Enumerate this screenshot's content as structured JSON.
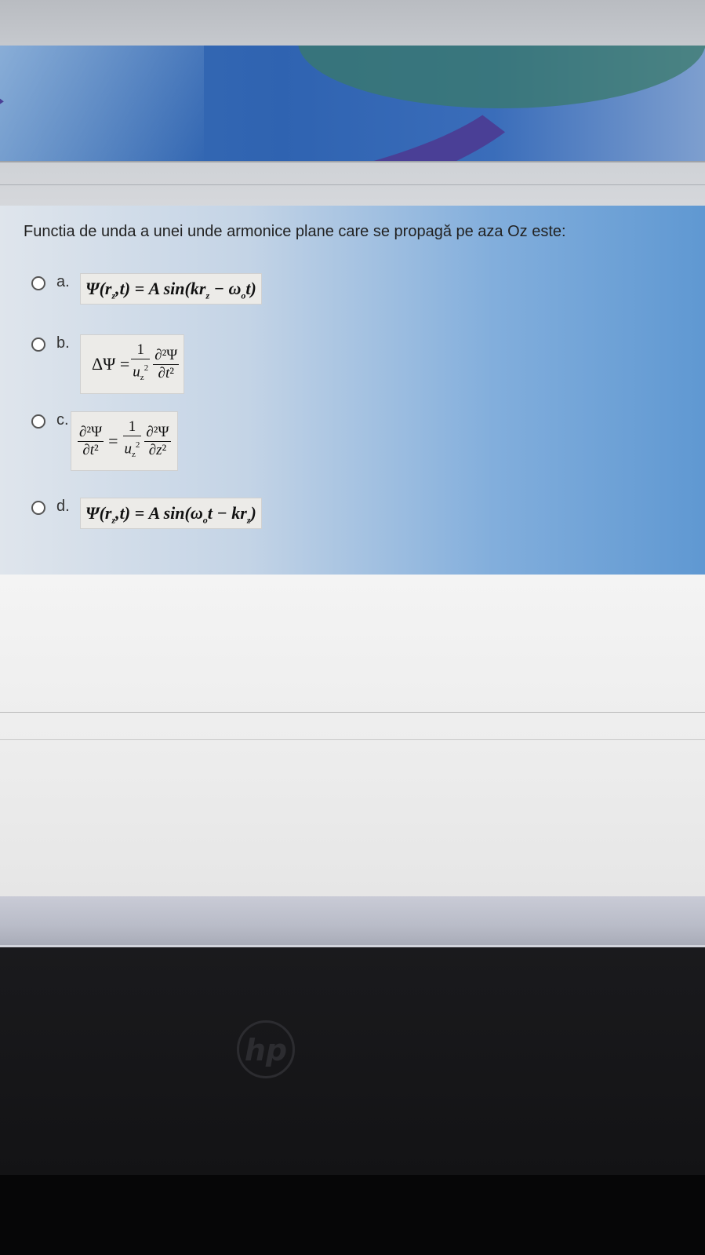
{
  "question": {
    "text": "Functia de unda a unei unde armonice plane care se propagă pe aza Oz este:"
  },
  "options": [
    {
      "letter": "a.",
      "formula_text": "Ψ(r_z,t) = A sin(kr_z − ω_0 t)",
      "selected": false
    },
    {
      "letter": "b.",
      "formula_text": "ΔΨ = (1/u_z²) ∂²Ψ/∂t²",
      "selected": false
    },
    {
      "letter": "c.",
      "formula_text": "∂²Ψ/∂t² = (1/u_z²) ∂²Ψ/∂z²",
      "selected": false
    },
    {
      "letter": "d.",
      "formula_text": "Ψ(r_z,t) = A sin(ω_0 t − kr_z)",
      "selected": false
    }
  ],
  "device": {
    "logo": "hp"
  },
  "colors": {
    "card_gradient_end": "#5f98d2",
    "bezel": "#131315"
  }
}
